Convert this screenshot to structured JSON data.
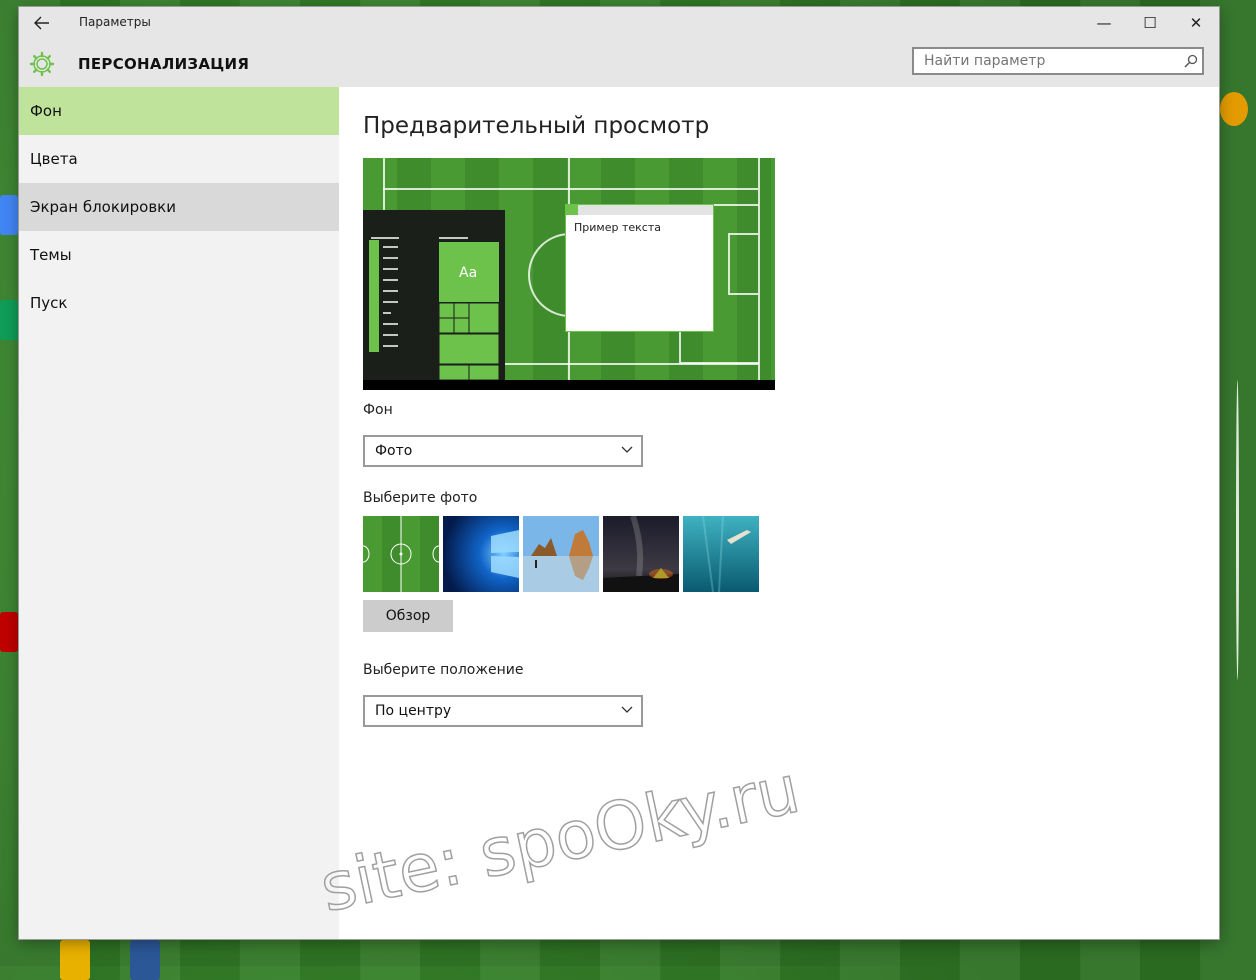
{
  "window": {
    "title": "Параметры",
    "minimize_glyph": "—",
    "maximize_glyph": "☐",
    "close_glyph": "✕"
  },
  "header": {
    "section_title": "ПЕРСОНАЛИЗАЦИЯ",
    "search_placeholder": "Найти параметр",
    "icon": "gear-icon",
    "accent_color": "#6cc24a"
  },
  "sidebar": {
    "items": [
      {
        "label": "Фон",
        "state": "selected"
      },
      {
        "label": "Цвета",
        "state": "normal"
      },
      {
        "label": "Экран блокировки",
        "state": "hover"
      },
      {
        "label": "Темы",
        "state": "normal"
      },
      {
        "label": "Пуск",
        "state": "normal"
      }
    ],
    "selected_color": "#bfe39a"
  },
  "main": {
    "heading": "Предварительный просмотр",
    "preview": {
      "sample_text": "Пример текста",
      "tile_text": "Aa"
    },
    "background": {
      "label": "Фон",
      "value": "Фото"
    },
    "choose_photo": {
      "label": "Выберите фото",
      "thumbnails": [
        "football-field",
        "windows-10-blue",
        "beach-rocks",
        "night-sky-tent",
        "underwater-swimmer"
      ],
      "browse_label": "Обзор"
    },
    "position": {
      "label": "Выберите положение",
      "value": "По центру"
    }
  },
  "watermark": "site: spoOky.ru"
}
